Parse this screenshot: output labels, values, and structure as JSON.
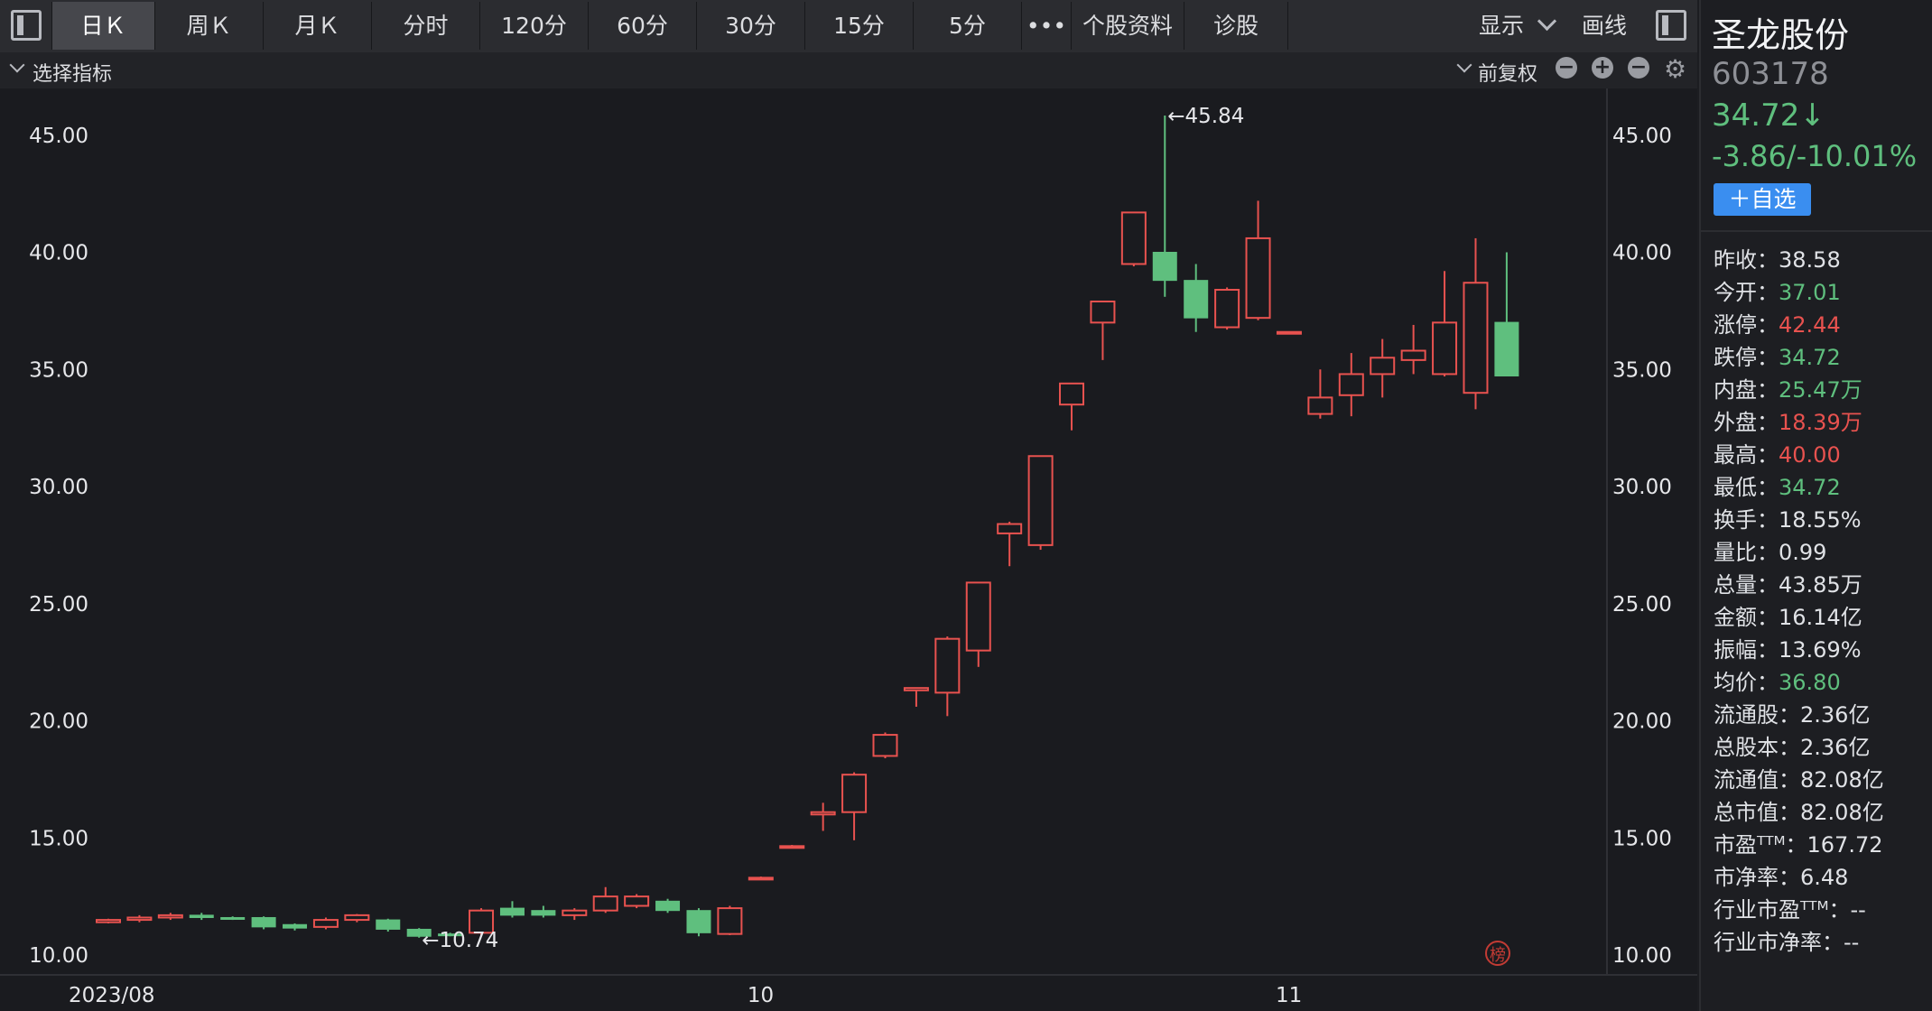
{
  "toolbar": {
    "tabs": [
      {
        "label": "日Ｋ",
        "active": true
      },
      {
        "label": "周Ｋ"
      },
      {
        "label": "月Ｋ"
      },
      {
        "label": "分时"
      },
      {
        "label": "120分"
      },
      {
        "label": "60分"
      },
      {
        "label": "30分"
      },
      {
        "label": "15分"
      },
      {
        "label": "5分"
      },
      {
        "label": "•••"
      },
      {
        "label": "个股资料"
      },
      {
        "label": "诊股"
      }
    ],
    "display_label": "显示",
    "draw_label": "画线"
  },
  "indicator_bar": {
    "select_label": "选择指标",
    "adjust_label": "前复权"
  },
  "stock": {
    "name": "圣龙股份",
    "code": "603178",
    "price": "34.72↓",
    "change": "-3.86/-10.01%",
    "watch_button": "＋自选"
  },
  "quote": [
    {
      "label": "昨收：",
      "value": "38.58",
      "color": "#e0e2e6"
    },
    {
      "label": "今开：",
      "value": "37.01",
      "color": "#5fbf7e"
    },
    {
      "label": "涨停：",
      "value": "42.44",
      "color": "#e8524f"
    },
    {
      "label": "跌停：",
      "value": "34.72",
      "color": "#5fbf7e"
    },
    {
      "label": "内盘：",
      "value": "25.47万",
      "color": "#5fbf7e"
    },
    {
      "label": "外盘：",
      "value": "18.39万",
      "color": "#e8524f"
    },
    {
      "label": "最高：",
      "value": "40.00",
      "color": "#e8524f"
    },
    {
      "label": "最低：",
      "value": "34.72",
      "color": "#5fbf7e"
    },
    {
      "label": "换手：",
      "value": "18.55%",
      "color": "#e0e2e6"
    },
    {
      "label": "量比：",
      "value": "0.99",
      "color": "#e0e2e6"
    },
    {
      "label": "总量：",
      "value": "43.85万",
      "color": "#e0e2e6"
    },
    {
      "label": "金额：",
      "value": "16.14亿",
      "color": "#e0e2e6"
    },
    {
      "label": "振幅：",
      "value": "13.69%",
      "color": "#e0e2e6"
    },
    {
      "label": "均价：",
      "value": "36.80",
      "color": "#5fbf7e"
    },
    {
      "label": "流通股：",
      "value": "2.36亿",
      "color": "#e0e2e6"
    },
    {
      "label": "总股本：",
      "value": "2.36亿",
      "color": "#e0e2e6"
    },
    {
      "label": "流通值：",
      "value": "82.08亿",
      "color": "#e0e2e6"
    },
    {
      "label": "总市值：",
      "value": "82.08亿",
      "color": "#e0e2e6"
    },
    {
      "label": "市盈ᵀᵀᴹ：",
      "value": "167.72",
      "color": "#e0e2e6"
    },
    {
      "label": "市净率：",
      "value": "6.48",
      "color": "#e0e2e6"
    },
    {
      "label": "行业市盈ᵀᵀᴹ：",
      "value": "--",
      "color": "#e0e2e6"
    },
    {
      "label": "行业市净率：",
      "value": "--",
      "color": "#e0e2e6"
    }
  ],
  "colors": {
    "up": "#e8524f",
    "down": "#5fbf7e",
    "background": "#1a1b1f",
    "axis_text": "#e6e7ea"
  },
  "chart_data": {
    "type": "candlestick",
    "ylim": [
      10,
      45.84
    ],
    "yticks": [
      "45.00",
      "40.00",
      "35.00",
      "30.00",
      "25.00",
      "20.00",
      "15.00",
      "10.00"
    ],
    "xticks": [
      {
        "label": "2023/08",
        "index": 0
      },
      {
        "label": "10",
        "index": 21
      },
      {
        "label": "11",
        "index": 38
      }
    ],
    "annotations": [
      {
        "text": "←45.84",
        "index": 34,
        "value": 45.84
      },
      {
        "text": "←10.74",
        "index": 10,
        "value": 10.74
      }
    ],
    "badge": "榜",
    "candles": [
      {
        "o": 11.4,
        "c": 11.5,
        "h": 11.55,
        "l": 11.35
      },
      {
        "o": 11.5,
        "c": 11.6,
        "h": 11.7,
        "l": 11.4
      },
      {
        "o": 11.6,
        "c": 11.7,
        "h": 11.8,
        "l": 11.5
      },
      {
        "o": 11.7,
        "c": 11.6,
        "h": 11.8,
        "l": 11.5
      },
      {
        "o": 11.6,
        "c": 11.55,
        "h": 11.65,
        "l": 11.5
      },
      {
        "o": 11.6,
        "c": 11.2,
        "h": 11.65,
        "l": 11.1
      },
      {
        "o": 11.3,
        "c": 11.15,
        "h": 11.35,
        "l": 11.05
      },
      {
        "o": 11.2,
        "c": 11.5,
        "h": 11.6,
        "l": 11.1
      },
      {
        "o": 11.5,
        "c": 11.7,
        "h": 11.75,
        "l": 11.4
      },
      {
        "o": 11.5,
        "c": 11.1,
        "h": 11.55,
        "l": 11.0
      },
      {
        "o": 11.1,
        "c": 10.8,
        "h": 11.15,
        "l": 10.74
      },
      {
        "o": 10.9,
        "c": 10.85,
        "h": 10.95,
        "l": 10.8
      },
      {
        "o": 10.95,
        "c": 11.9,
        "h": 12.0,
        "l": 10.85
      },
      {
        "o": 12.0,
        "c": 11.7,
        "h": 12.3,
        "l": 11.6
      },
      {
        "o": 11.9,
        "c": 11.7,
        "h": 12.1,
        "l": 11.6
      },
      {
        "o": 11.7,
        "c": 11.9,
        "h": 12.0,
        "l": 11.5
      },
      {
        "o": 11.9,
        "c": 12.5,
        "h": 12.9,
        "l": 11.8
      },
      {
        "o": 12.1,
        "c": 12.5,
        "h": 12.6,
        "l": 12.0
      },
      {
        "o": 12.3,
        "c": 11.9,
        "h": 12.4,
        "l": 11.8
      },
      {
        "o": 11.9,
        "c": 10.95,
        "h": 12.0,
        "l": 10.8
      },
      {
        "o": 10.9,
        "c": 12.0,
        "h": 12.1,
        "l": 10.85
      },
      {
        "o": 13.25,
        "c": 13.3,
        "h": 13.35,
        "l": 13.2
      },
      {
        "o": 14.6,
        "c": 14.65,
        "h": 14.7,
        "l": 14.55
      },
      {
        "o": 16.0,
        "c": 16.1,
        "h": 16.5,
        "l": 15.3
      },
      {
        "o": 16.1,
        "c": 17.7,
        "h": 17.8,
        "l": 14.9
      },
      {
        "o": 18.5,
        "c": 19.4,
        "h": 19.5,
        "l": 18.4
      },
      {
        "o": 21.3,
        "c": 21.4,
        "h": 21.4,
        "l": 20.6
      },
      {
        "o": 21.2,
        "c": 23.5,
        "h": 23.6,
        "l": 20.2
      },
      {
        "o": 23.0,
        "c": 25.9,
        "h": 25.9,
        "l": 22.3
      },
      {
        "o": 28.0,
        "c": 28.4,
        "h": 28.5,
        "l": 26.6
      },
      {
        "o": 27.5,
        "c": 31.3,
        "h": 31.3,
        "l": 27.3
      },
      {
        "o": 33.5,
        "c": 34.4,
        "h": 34.4,
        "l": 32.4
      },
      {
        "o": 37.0,
        "c": 37.9,
        "h": 37.9,
        "l": 35.4
      },
      {
        "o": 39.5,
        "c": 41.7,
        "h": 41.7,
        "l": 39.4
      },
      {
        "o": 40.0,
        "c": 38.8,
        "h": 45.84,
        "l": 38.1
      },
      {
        "o": 38.8,
        "c": 37.2,
        "h": 39.5,
        "l": 36.6
      },
      {
        "o": 36.8,
        "c": 38.4,
        "h": 38.5,
        "l": 36.7
      },
      {
        "o": 37.2,
        "c": 40.6,
        "h": 42.2,
        "l": 37.1
      },
      {
        "o": 36.55,
        "c": 36.6,
        "h": 36.6,
        "l": 36.5
      },
      {
        "o": 33.1,
        "c": 33.8,
        "h": 35.0,
        "l": 32.9
      },
      {
        "o": 33.9,
        "c": 34.8,
        "h": 35.7,
        "l": 33.0
      },
      {
        "o": 34.8,
        "c": 35.5,
        "h": 36.3,
        "l": 33.8
      },
      {
        "o": 35.4,
        "c": 35.8,
        "h": 36.9,
        "l": 34.8
      },
      {
        "o": 34.8,
        "c": 37.0,
        "h": 39.2,
        "l": 34.7
      },
      {
        "o": 34.0,
        "c": 38.7,
        "h": 40.6,
        "l": 33.3
      },
      {
        "o": 37.01,
        "c": 34.72,
        "h": 40.0,
        "l": 34.72
      }
    ]
  }
}
